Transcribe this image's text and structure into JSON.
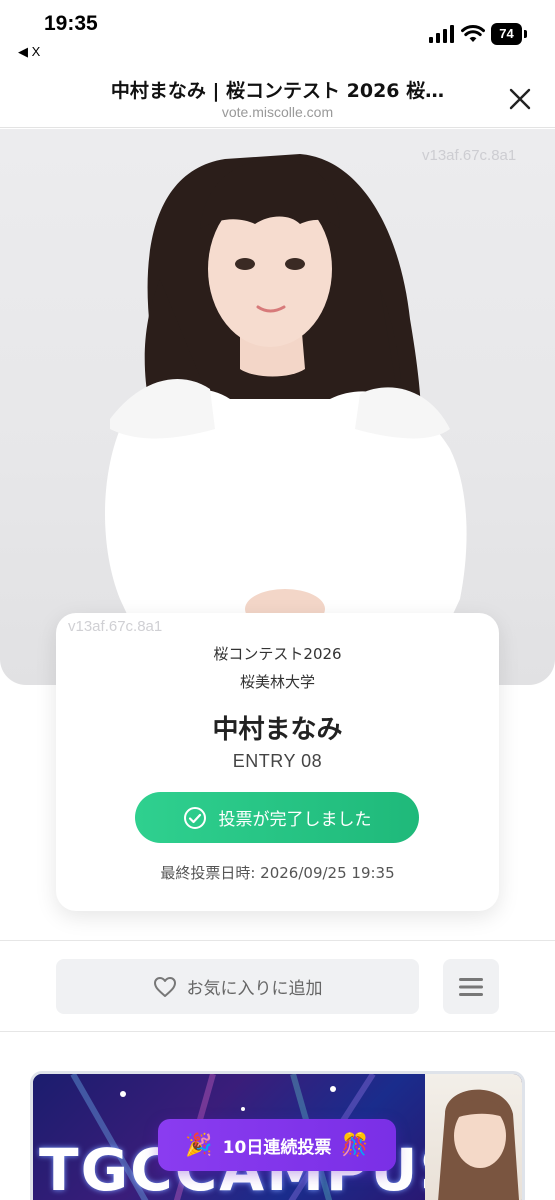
{
  "status_bar": {
    "time": "19:35",
    "back_label": "◀ X",
    "battery": "74"
  },
  "browser": {
    "title": "中村まなみ | 桜コンテスト 2026 桜…",
    "url": "vote.miscolle.com"
  },
  "photo": {
    "watermark_top": "v13af.67c.8a1",
    "watermark_card": "v13af.67c.8a1"
  },
  "profile": {
    "contest": "桜コンテスト2026",
    "university": "桜美林大学",
    "name": "中村まなみ",
    "entry": "ENTRY 08",
    "vote_status": "投票が完了しました",
    "last_vote": "最終投票日時: 2026/09/25 19:35"
  },
  "actions": {
    "favorite_label": "お気に入りに追加"
  },
  "banner": {
    "text": "TGCCAMPUS",
    "streak_label": "10日連続投票"
  },
  "colors": {
    "accent_green": "#22c07f",
    "streak_purple": "#7f33ea"
  },
  "icons": [
    "back-arrow-icon",
    "signal-icon",
    "wifi-icon",
    "battery-icon",
    "close-icon",
    "check-circle-icon",
    "heart-icon",
    "menu-icon",
    "party-popper-icon",
    "party-balls-icon"
  ]
}
